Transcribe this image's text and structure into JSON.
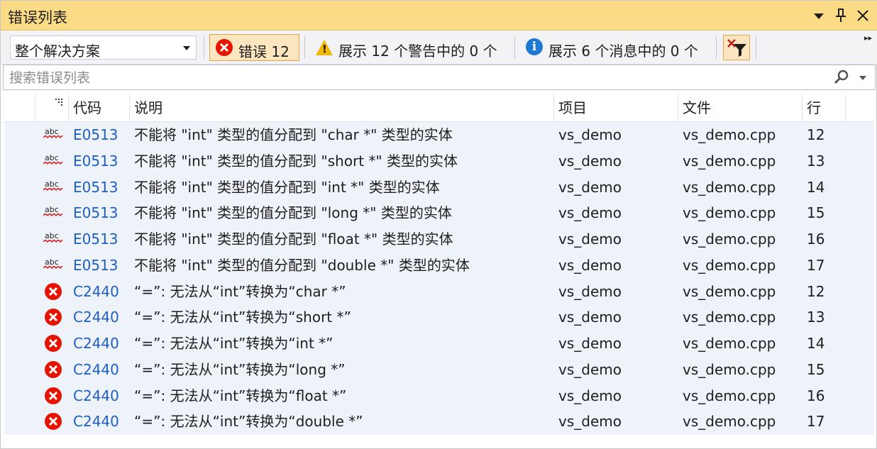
{
  "window": {
    "title": "错误列表"
  },
  "toolbar": {
    "scope": "整个解决方案",
    "errors_label": "错误 12",
    "warnings_label": "展示 12 个警告中的 0 个",
    "messages_label": "展示 6 个消息中的 0 个",
    "overflow_glyph": "▸▸"
  },
  "search": {
    "placeholder": "搜索错误列表"
  },
  "columns": {
    "code": "代码",
    "description": "说明",
    "project": "项目",
    "file": "文件",
    "line": "行"
  },
  "rows": [
    {
      "icon": "spelling-squiggle-icon",
      "code": "E0513",
      "description": "不能将 \"int\" 类型的值分配到 \"char *\" 类型的实体",
      "project": "vs_demo",
      "file": "vs_demo.cpp",
      "line": "12"
    },
    {
      "icon": "spelling-squiggle-icon",
      "code": "E0513",
      "description": "不能将 \"int\" 类型的值分配到 \"short *\" 类型的实体",
      "project": "vs_demo",
      "file": "vs_demo.cpp",
      "line": "13"
    },
    {
      "icon": "spelling-squiggle-icon",
      "code": "E0513",
      "description": "不能将 \"int\" 类型的值分配到 \"int *\" 类型的实体",
      "project": "vs_demo",
      "file": "vs_demo.cpp",
      "line": "14"
    },
    {
      "icon": "spelling-squiggle-icon",
      "code": "E0513",
      "description": "不能将 \"int\" 类型的值分配到 \"long *\" 类型的实体",
      "project": "vs_demo",
      "file": "vs_demo.cpp",
      "line": "15"
    },
    {
      "icon": "spelling-squiggle-icon",
      "code": "E0513",
      "description": "不能将 \"int\" 类型的值分配到 \"float *\" 类型的实体",
      "project": "vs_demo",
      "file": "vs_demo.cpp",
      "line": "16"
    },
    {
      "icon": "spelling-squiggle-icon",
      "code": "E0513",
      "description": "不能将 \"int\" 类型的值分配到 \"double *\" 类型的实体",
      "project": "vs_demo",
      "file": "vs_demo.cpp",
      "line": "17"
    },
    {
      "icon": "error-icon",
      "code": "C2440",
      "description": "“=”: 无法从“int”转换为“char *”",
      "project": "vs_demo",
      "file": "vs_demo.cpp",
      "line": "12"
    },
    {
      "icon": "error-icon",
      "code": "C2440",
      "description": "“=”: 无法从“int”转换为“short *”",
      "project": "vs_demo",
      "file": "vs_demo.cpp",
      "line": "13"
    },
    {
      "icon": "error-icon",
      "code": "C2440",
      "description": "“=”: 无法从“int”转换为“int *”",
      "project": "vs_demo",
      "file": "vs_demo.cpp",
      "line": "14"
    },
    {
      "icon": "error-icon",
      "code": "C2440",
      "description": "“=”: 无法从“int”转换为“long *”",
      "project": "vs_demo",
      "file": "vs_demo.cpp",
      "line": "15"
    },
    {
      "icon": "error-icon",
      "code": "C2440",
      "description": "“=”: 无法从“int”转换为“float *”",
      "project": "vs_demo",
      "file": "vs_demo.cpp",
      "line": "16"
    },
    {
      "icon": "error-icon",
      "code": "C2440",
      "description": "“=”: 无法从“int”转换为“double *”",
      "project": "vs_demo",
      "file": "vs_demo.cpp",
      "line": "17"
    }
  ],
  "colors": {
    "titlebar": "#fcdb87",
    "error": "#e51400",
    "warning": "#f2b705",
    "info": "#1c7ad2",
    "code_link": "#1f5fc4",
    "row_bg": "#eef2f9"
  }
}
